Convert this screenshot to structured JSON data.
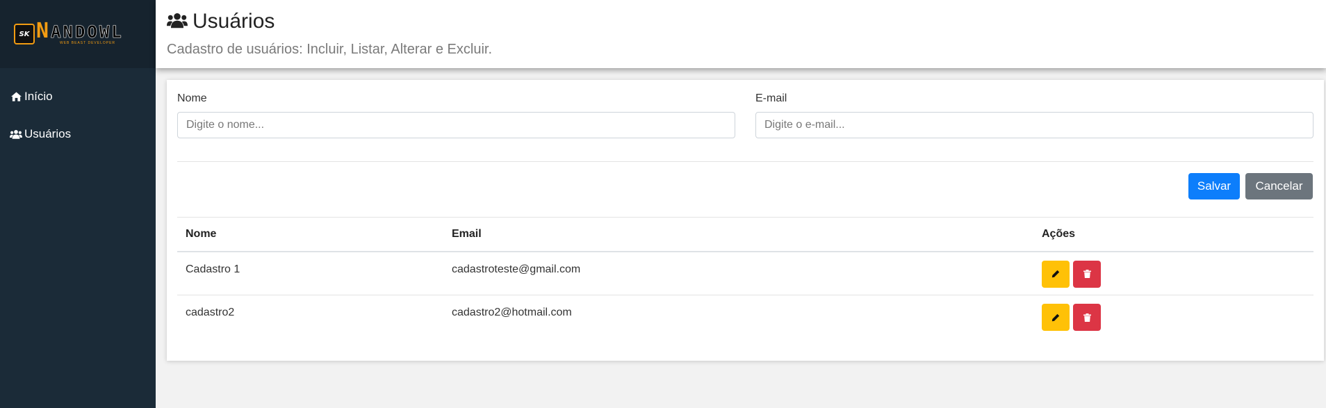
{
  "sidebar": {
    "logo": {
      "badge": "SK",
      "name_first": "N",
      "name_rest": "ANDOWL",
      "subtitle": "WEB BEAST DEVELOPER"
    },
    "items": [
      {
        "label": "Início",
        "icon": "home-icon"
      },
      {
        "label": "Usuários",
        "icon": "users-icon"
      }
    ]
  },
  "header": {
    "title": "Usuários",
    "title_icon": "users-icon",
    "subtitle": "Cadastro de usuários: Incluir, Listar, Alterar e Excluir."
  },
  "form": {
    "name_label": "Nome",
    "name_placeholder": "Digite o nome...",
    "name_value": "",
    "email_label": "E-mail",
    "email_placeholder": "Digite o e-mail...",
    "email_value": "",
    "save_label": "Salvar",
    "cancel_label": "Cancelar"
  },
  "table": {
    "headers": [
      "Nome",
      "Email",
      "Ações"
    ],
    "rows": [
      {
        "name": "Cadastro 1",
        "email": "cadastroteste@gmail.com"
      },
      {
        "name": "cadastro2",
        "email": "cadastro2@hotmail.com"
      }
    ]
  },
  "colors": {
    "sidebar_bg": "#1b2b38",
    "primary": "#0d7efb",
    "secondary": "#6c757d",
    "warning": "#ffc107",
    "danger": "#dc3545",
    "logo_accent": "#f39c12"
  }
}
